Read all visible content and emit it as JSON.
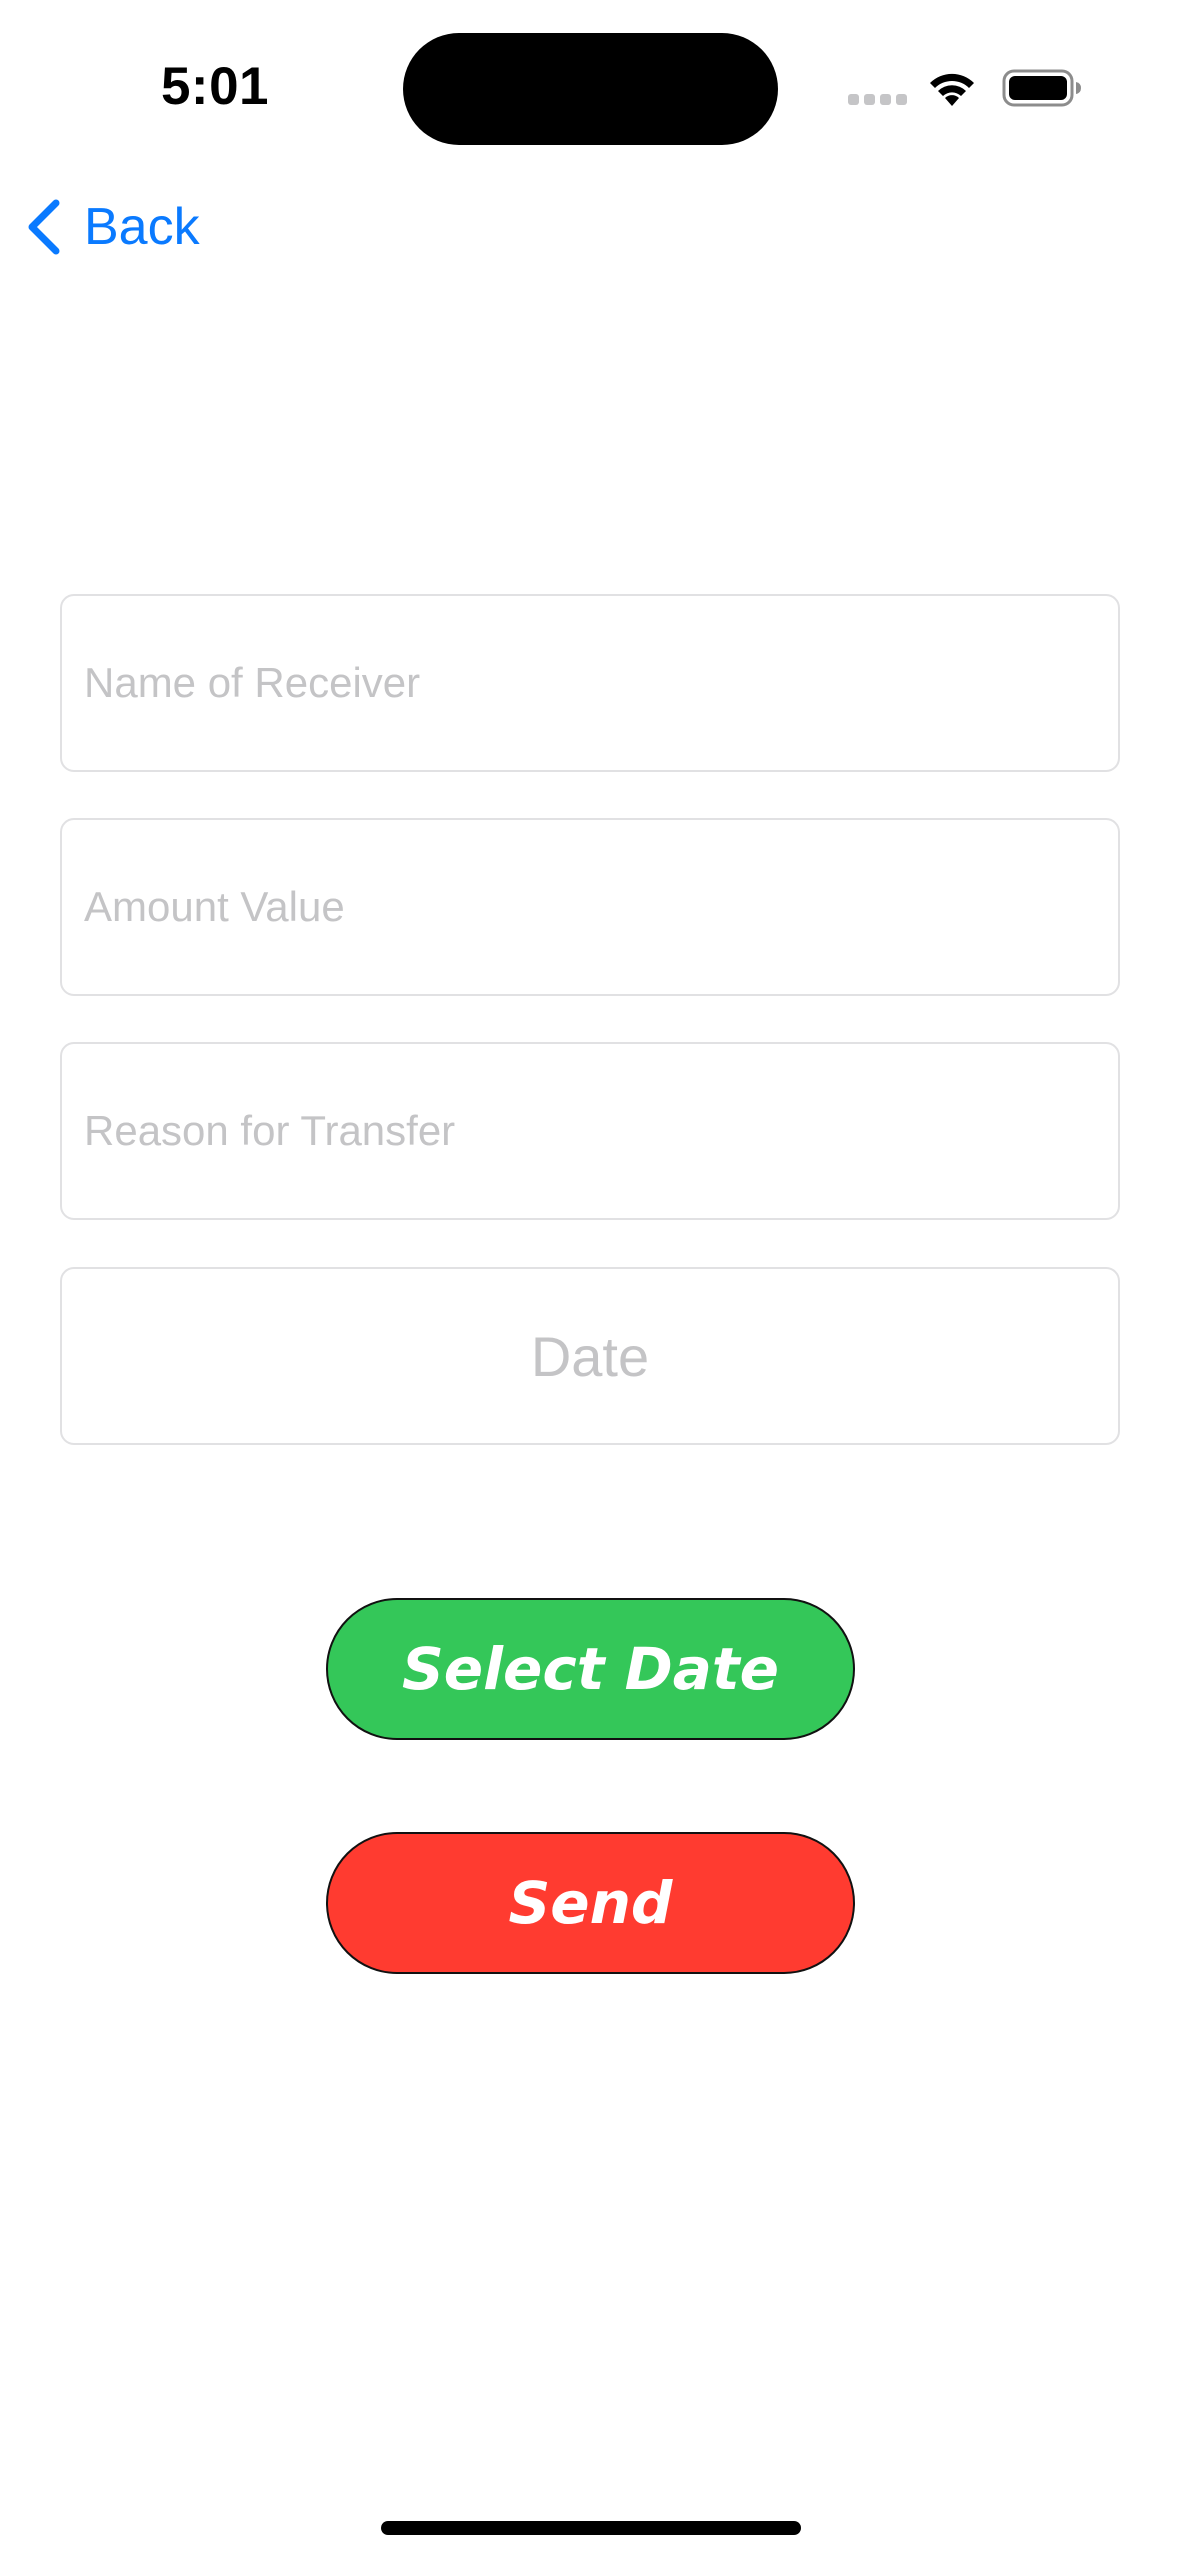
{
  "status_bar": {
    "time": "5:01"
  },
  "nav": {
    "back_label": "Back"
  },
  "form": {
    "name_placeholder": "Name of Receiver",
    "amount_placeholder": "Amount Value",
    "reason_placeholder": "Reason for Transfer",
    "date_placeholder": "Date"
  },
  "buttons": {
    "select_date_label": "Select Date",
    "send_label": "Send"
  },
  "colors": {
    "accent": "#0a7aff",
    "select_date": "#34c759",
    "send": "#ff3b30",
    "placeholder": "#c4c4c6"
  },
  "icons": {
    "back": "chevron-left-icon",
    "wifi": "wifi-icon",
    "battery": "battery-icon",
    "signal": "cellular-signal-icon"
  }
}
